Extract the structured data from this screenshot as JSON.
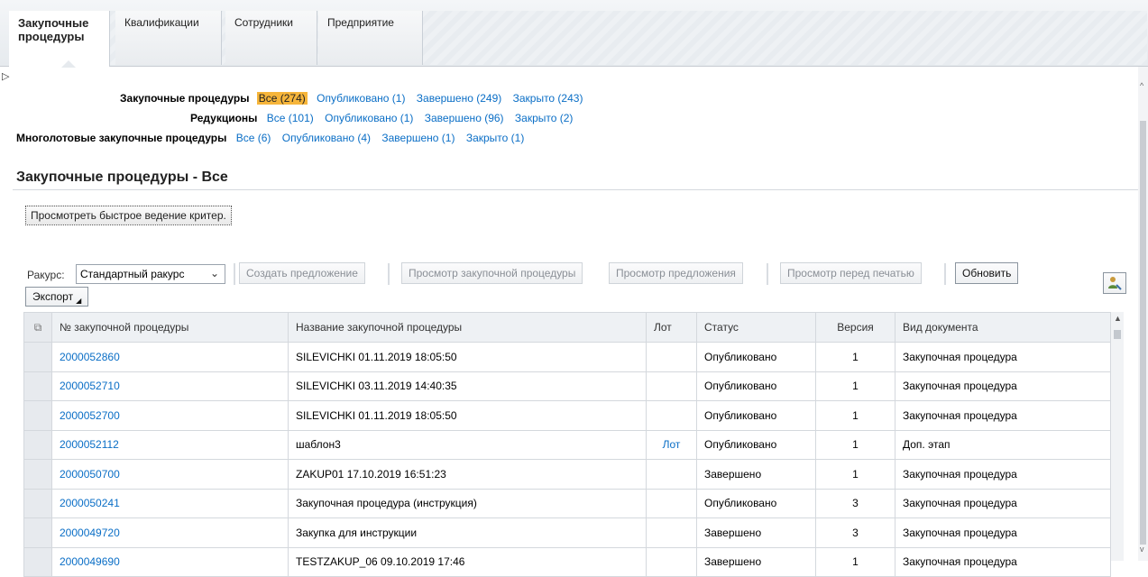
{
  "tabs": [
    {
      "label": "Закупочные процедуры",
      "active": true
    },
    {
      "label": "Квалификации",
      "active": false
    },
    {
      "label": "Сотрудники",
      "active": false
    },
    {
      "label": "Предприятие",
      "active": false
    }
  ],
  "summary": {
    "procedures": {
      "label": "Закупочные процедуры",
      "all": "Все (274)",
      "published": "Опубликовано (1)",
      "completed": "Завершено (249)",
      "closed": "Закрыто (243)"
    },
    "auctions": {
      "label": "Редукционы",
      "all": "Все (101)",
      "published": "Опубликовано (1)",
      "completed": "Завершено (96)",
      "closed": "Закрыто (2)"
    },
    "multilot": {
      "label": "Многолотовые закупочные процедуры",
      "all": "Все (6)",
      "published": "Опубликовано (4)",
      "completed": "Завершено (1)",
      "closed": "Закрыто (1)"
    }
  },
  "section_title": "Закупочные процедуры - Все",
  "quick_criteria_button": "Просмотреть быстрое ведение критер.",
  "toolbar": {
    "view_label": "Ракурс:",
    "view_value": "Стандартный ракурс",
    "create_offer": "Создать предложение",
    "view_procedure": "Просмотр закупочной процедуры",
    "view_offer": "Просмотр предложения",
    "print_preview": "Просмотр перед печатью",
    "refresh": "Обновить",
    "export": "Экспорт"
  },
  "table": {
    "columns": [
      "№ закупочной процедуры",
      "Название закупочной процедуры",
      "Лот",
      "Статус",
      "Версия",
      "Вид документа"
    ],
    "rows": [
      {
        "num": "2000052860",
        "name": "SILEVICHKI 01.11.2019 18:05:50",
        "lot": "",
        "status": "Опубликовано",
        "version": "1",
        "doctype": "Закупочная процедура"
      },
      {
        "num": "2000052710",
        "name": "SILEVICHKI 03.11.2019 14:40:35",
        "lot": "",
        "status": "Опубликовано",
        "version": "1",
        "doctype": "Закупочная процедура"
      },
      {
        "num": "2000052700",
        "name": "SILEVICHKI 01.11.2019 18:05:50",
        "lot": "",
        "status": "Опубликовано",
        "version": "1",
        "doctype": "Закупочная процедура"
      },
      {
        "num": "2000052112",
        "name": "шаблон3",
        "lot": "Лот",
        "status": "Опубликовано",
        "version": "1",
        "doctype": "Доп. этап"
      },
      {
        "num": "2000050700",
        "name": "ZAKUP01 17.10.2019 16:51:23",
        "lot": "",
        "status": "Завершено",
        "version": "1",
        "doctype": "Закупочная процедура"
      },
      {
        "num": "2000050241",
        "name": "Закупочная процедура (инструкция)",
        "lot": "",
        "status": "Опубликовано",
        "version": "3",
        "doctype": "Закупочная процедура"
      },
      {
        "num": "2000049720",
        "name": "Закупка для инструкции",
        "lot": "",
        "status": "Завершено",
        "version": "3",
        "doctype": "Закупочная процедура"
      },
      {
        "num": "2000049690",
        "name": "TESTZAKUP_06 09.10.2019 17:46",
        "lot": "",
        "status": "Завершено",
        "version": "1",
        "doctype": "Закупочная процедура"
      }
    ]
  },
  "colors": {
    "link": "#0a6ec6",
    "active_filter": "#f6b53a"
  }
}
